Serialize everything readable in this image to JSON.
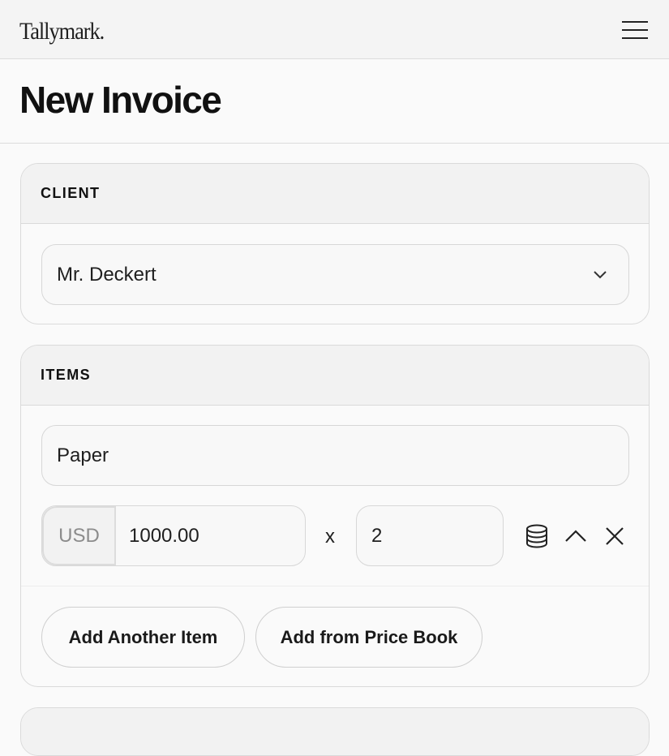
{
  "app": {
    "logo": "Tallymark."
  },
  "page": {
    "title": "New Invoice"
  },
  "client_section": {
    "heading": "CLIENT",
    "selected_client": "Mr. Deckert"
  },
  "items_section": {
    "heading": "ITEMS",
    "item": {
      "description": "Paper",
      "currency": "USD",
      "price": "1000.00",
      "multiplier_symbol": "x",
      "quantity": "2"
    },
    "buttons": {
      "add_another": "Add Another Item",
      "add_from_price_book": "Add from Price Book"
    },
    "icons": [
      "database-icon",
      "chevron-up-icon",
      "close-icon"
    ]
  }
}
